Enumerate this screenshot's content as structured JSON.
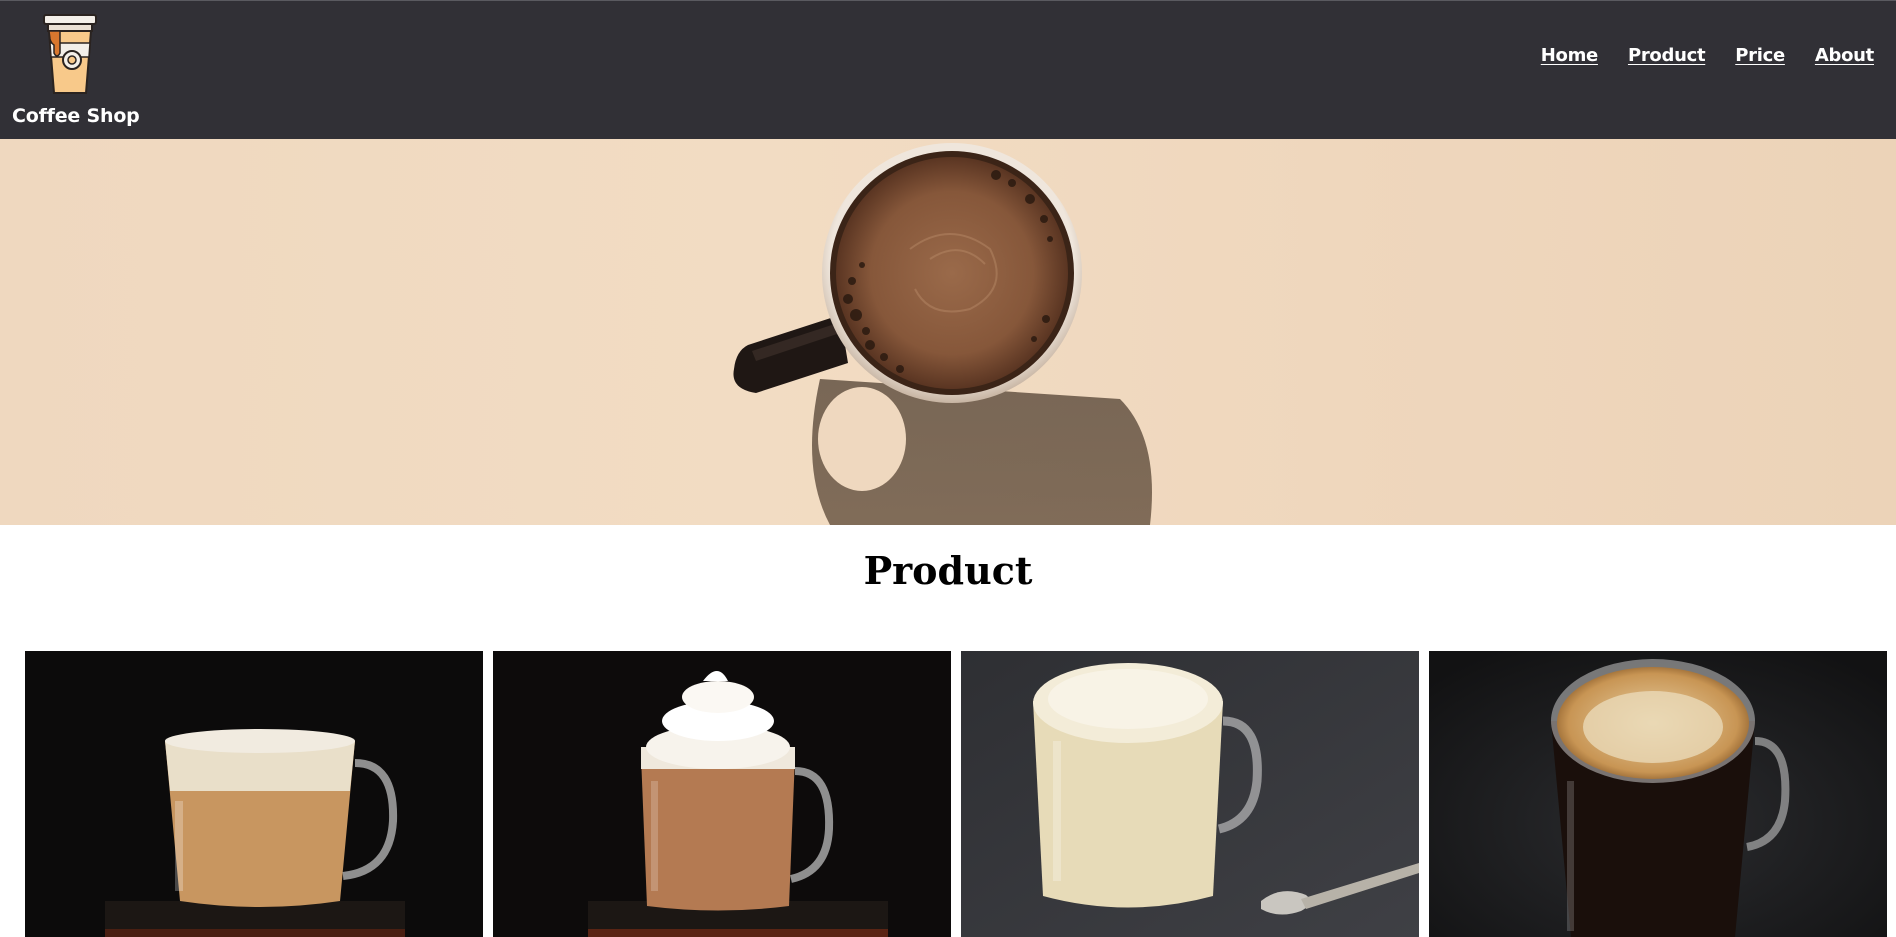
{
  "brand": {
    "name": "Coffee Shop",
    "logo_icon": "coffee-cup-icon"
  },
  "nav": {
    "items": [
      {
        "label": "Home"
      },
      {
        "label": "Product"
      },
      {
        "label": "Price"
      },
      {
        "label": "About"
      }
    ]
  },
  "hero": {
    "image": "coffee-mug-top-view",
    "background_color": "#efd8bf"
  },
  "product_section": {
    "title": "Product",
    "cards": [
      {
        "image": "latte-in-glass-mug"
      },
      {
        "image": "mocha-with-whipped-cream"
      },
      {
        "image": "flat-white-with-spoon"
      },
      {
        "image": "americano-in-glass-mug"
      }
    ]
  },
  "colors": {
    "header_bg": "#313036",
    "nav_text": "#ffffff",
    "title_text": "#000000"
  }
}
